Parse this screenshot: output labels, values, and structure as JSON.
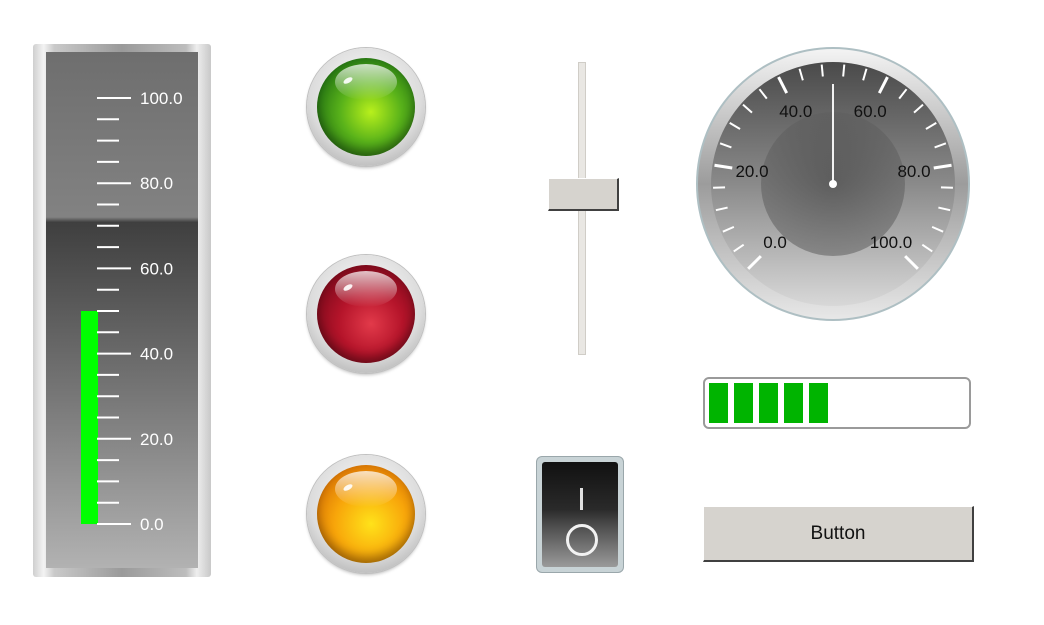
{
  "meter": {
    "scale_labels": [
      "100.0",
      "80.0",
      "60.0",
      "40.0",
      "20.0",
      "0.0"
    ],
    "range": [
      0,
      100
    ],
    "value": 50,
    "fill_color": "#00ff00"
  },
  "lamps": [
    {
      "name": "green",
      "color": "#59b21a",
      "icon": "indicator-lamp"
    },
    {
      "name": "red",
      "color": "#b5142a",
      "icon": "indicator-lamp"
    },
    {
      "name": "orange",
      "color": "#f8a60a",
      "icon": "indicator-lamp"
    }
  ],
  "slider": {
    "value_fraction": 0.55
  },
  "switch": {
    "state": "off",
    "icons": [
      "power-on-bar-icon",
      "power-off-ring-icon"
    ]
  },
  "gauge": {
    "scale_labels": [
      "0.0",
      "20.0",
      "40.0",
      "60.0",
      "80.0",
      "100.0"
    ],
    "range": [
      0,
      100
    ],
    "value": 50
  },
  "progress": {
    "value_percent": 47,
    "color": "#00b400"
  },
  "button": {
    "label": "Button"
  }
}
